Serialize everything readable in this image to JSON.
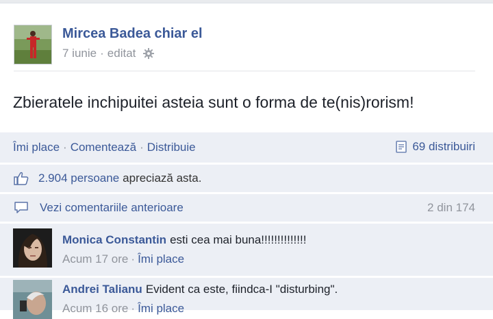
{
  "post": {
    "author": "Mircea Badea chiar el",
    "date": "7 iunie",
    "edited": "editat",
    "message": "Zbieratele inchipuitei asteia sunt o forma de te(nis)rorism!"
  },
  "actions": {
    "like": "Îmi place",
    "comment": "Comentează",
    "share": "Distribuie",
    "shares_count": "69 distribuiri"
  },
  "likes": {
    "count": "2.904 persoane",
    "text": "apreciază asta."
  },
  "previous": {
    "label": "Vezi comentariile anterioare",
    "pager": "2 din 174"
  },
  "comments": [
    {
      "author": "Monica Constantin",
      "text": "esti cea mai buna!!!!!!!!!!!!!!",
      "time": "Acum 17 ore",
      "like": "Îmi place"
    },
    {
      "author": "Andrei Talianu",
      "text": "Evident ca este, fiindca-I \"disturbing\".",
      "time": "Acum 16 ore",
      "like": "Îmi place"
    }
  ],
  "icons": {
    "settings": "gear-icon",
    "shares": "share-document-icon",
    "likes": "thumbs-up-icon",
    "comments": "comment-bubble-icon"
  },
  "colors": {
    "link": "#3b5998",
    "bar_bg": "#eceff5",
    "muted": "#90949c"
  }
}
